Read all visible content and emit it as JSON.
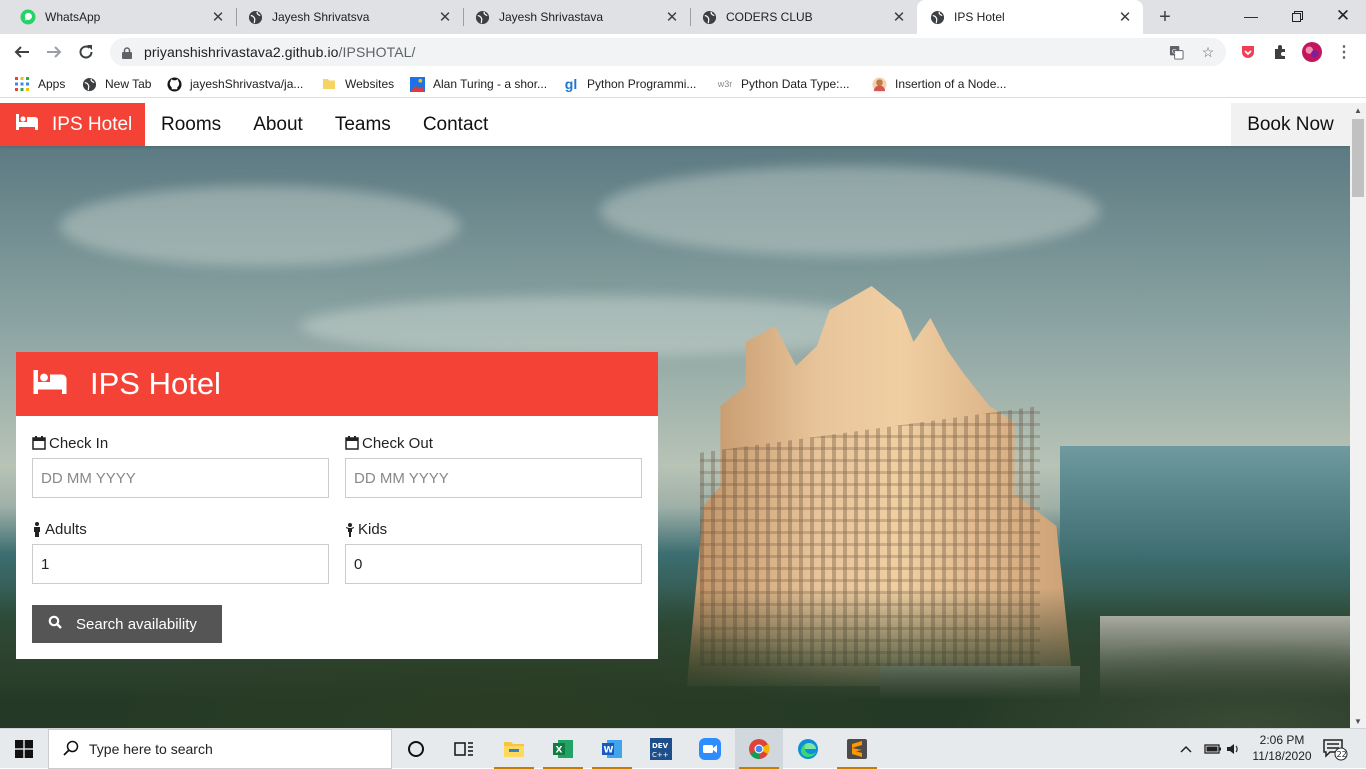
{
  "browser": {
    "tabs": [
      {
        "title": "WhatsApp",
        "icon": "whatsapp-icon"
      },
      {
        "title": "Jayesh Shrivatsva",
        "icon": "globe-icon"
      },
      {
        "title": "Jayesh Shrivastava",
        "icon": "globe-icon"
      },
      {
        "title": "CODERS CLUB",
        "icon": "globe-icon"
      },
      {
        "title": "IPS Hotel",
        "icon": "globe-icon",
        "active": true
      }
    ],
    "url_host": "priyanshishrivastava2.github.io",
    "url_path": "/IPSHOTAL/",
    "bookmarks": [
      {
        "label": "Apps",
        "icon": "apps-grid-icon"
      },
      {
        "label": "New Tab",
        "icon": "globe-icon"
      },
      {
        "label": "jayeshShrivastva/ja...",
        "icon": "github-icon"
      },
      {
        "label": "Websites",
        "icon": "folder-icon"
      },
      {
        "label": "Alan Turing - a shor...",
        "icon": "image-icon"
      },
      {
        "label": "Python Programmi...",
        "icon": "gl-icon"
      },
      {
        "label": "Python Data Type:...",
        "icon": "w3-icon"
      },
      {
        "label": "Insertion of a Node...",
        "icon": "avatar-icon"
      }
    ]
  },
  "site": {
    "brand": "IPS Hotel",
    "nav": [
      "Rooms",
      "About",
      "Teams",
      "Contact"
    ],
    "book_now": "Book Now"
  },
  "booking": {
    "title": "IPS Hotel",
    "check_in_label": "Check In",
    "check_in_placeholder": "DD MM YYYY",
    "check_out_label": "Check Out",
    "check_out_placeholder": "DD MM YYYY",
    "adults_label": "Adults",
    "adults_value": "1",
    "kids_label": "Kids",
    "kids_value": "0",
    "search_label": "Search availability"
  },
  "taskbar": {
    "search_placeholder": "Type here to search",
    "time": "2:06 PM",
    "date": "11/18/2020",
    "notifications": "22",
    "apps": [
      "task-view-icon",
      "file-explorer-icon",
      "excel-icon",
      "word-icon",
      "dev-icon",
      "zoom-icon",
      "chrome-icon",
      "edge-icon",
      "sublime-icon"
    ]
  },
  "colors": {
    "brand_red": "#f44336",
    "search_button": "#555555",
    "book_now_bg": "#f1f1f1"
  }
}
